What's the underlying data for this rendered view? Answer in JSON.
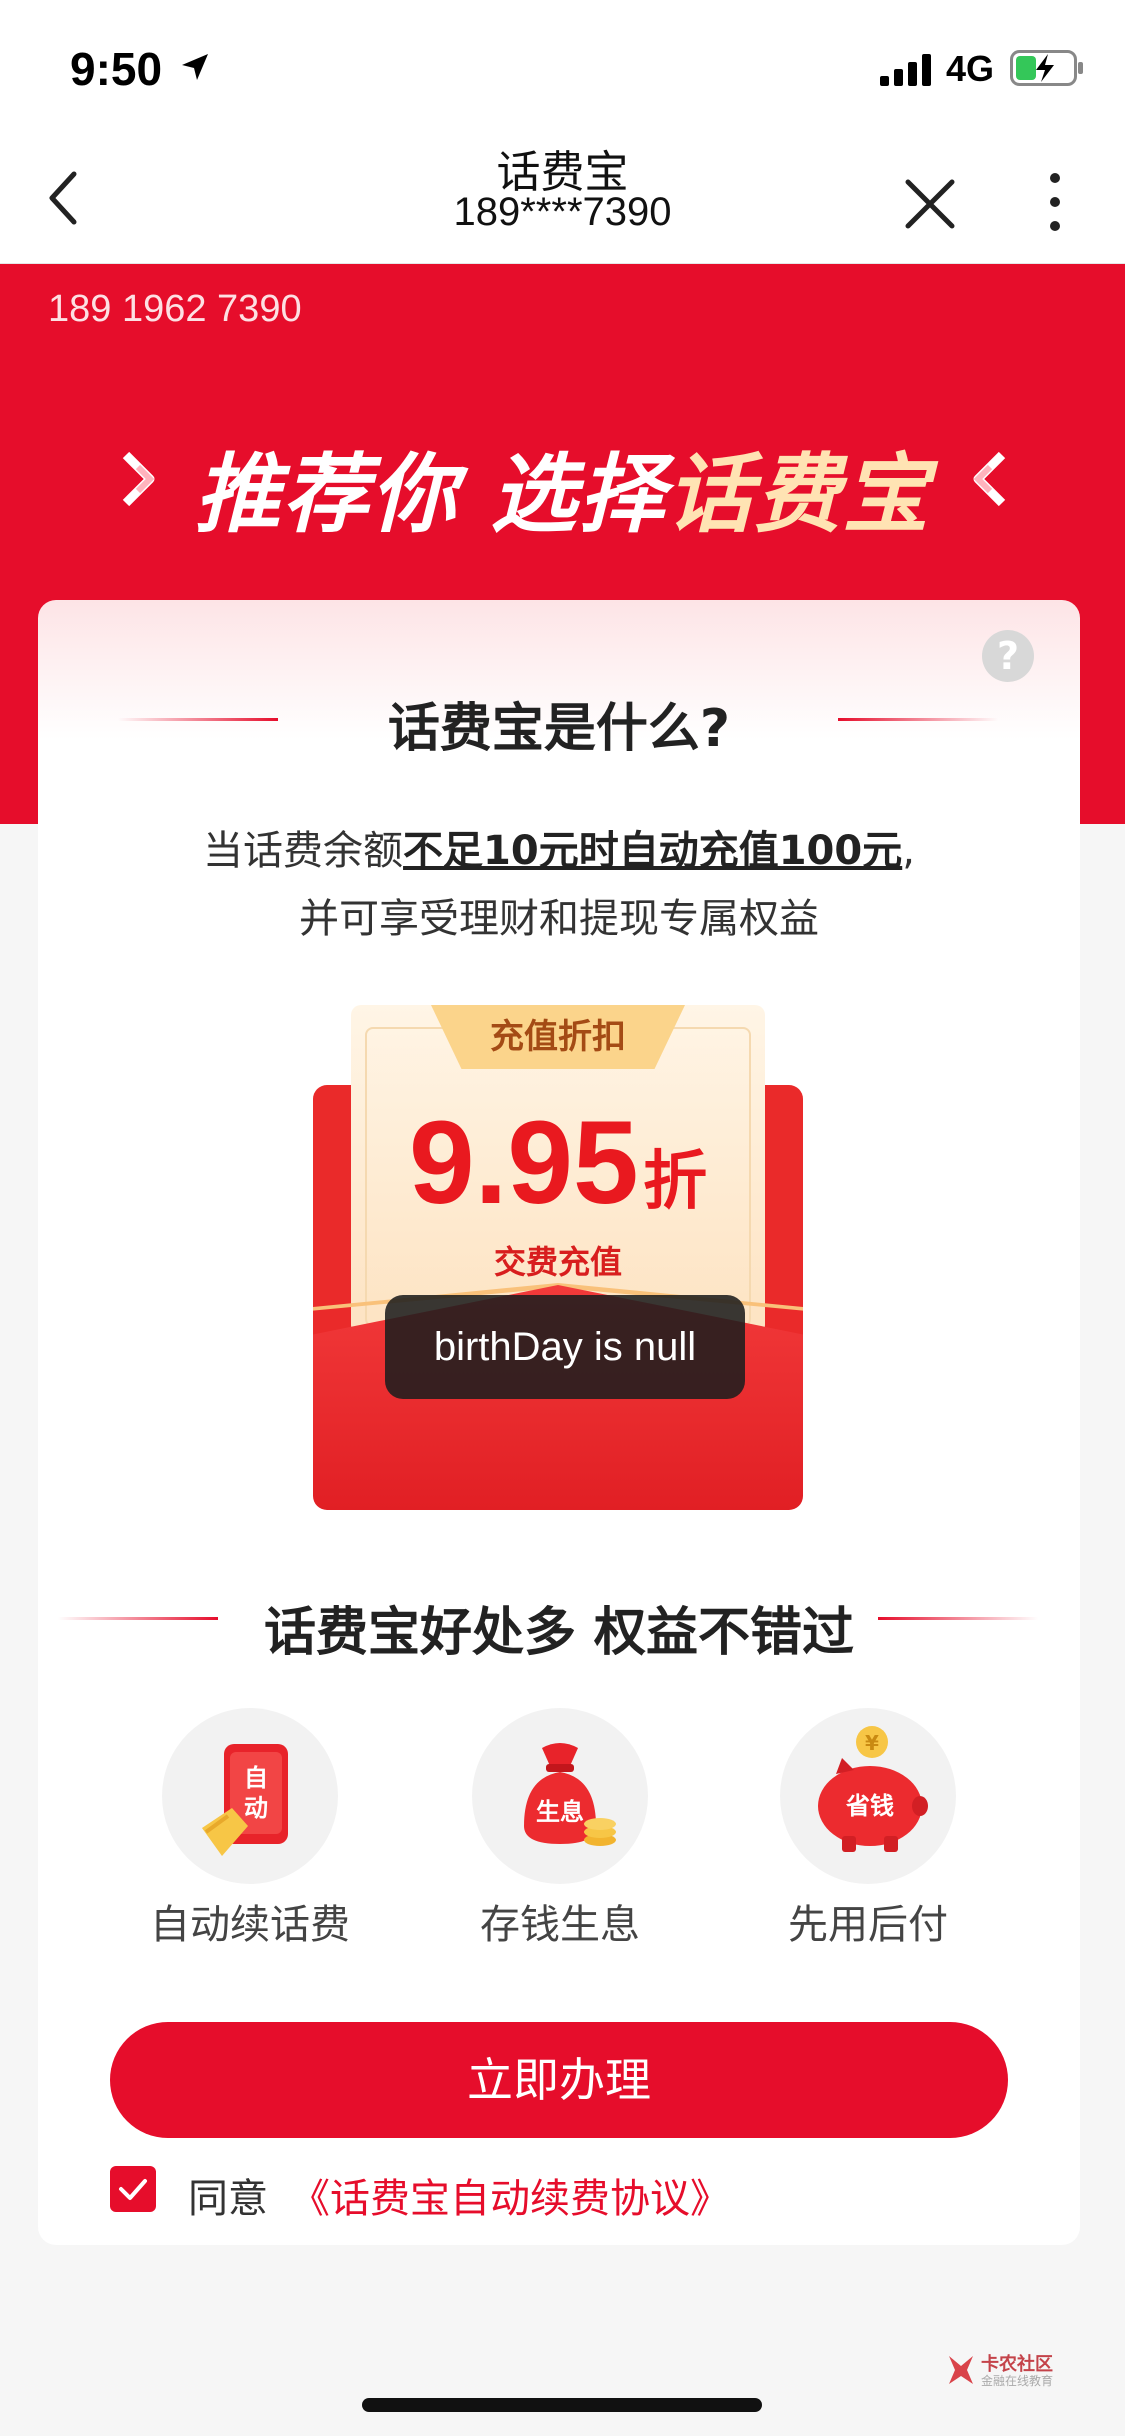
{
  "status_bar": {
    "time": "9:50",
    "network": "4G",
    "icons": [
      "location-arrow-icon",
      "signal-icon",
      "battery-charging-icon"
    ]
  },
  "nav": {
    "title": "话费宝",
    "subtitle": "189****7390",
    "icons": [
      "back-icon",
      "close-icon",
      "more-icon"
    ]
  },
  "hero": {
    "phone": "189 1962 7390",
    "title_part1": "推荐你 选择",
    "title_part2": "话费宝"
  },
  "card": {
    "what_title": "话费宝是什么?",
    "desc_prefix": "当话费余额",
    "desc_highlight": "不足10元时自动充值100元",
    "desc_suffix": ",",
    "desc_line2": "并可享受理财和提现专属权益",
    "envelope": {
      "tag": "充值折扣",
      "discount_value": "9.95",
      "discount_unit": "折",
      "subtitle": "交费充值"
    },
    "toast": "birthDay is null",
    "benefits_title": "话费宝好处多 权益不错过",
    "benefits": [
      {
        "label": "自动续话费",
        "icon": "auto-renew-phone-icon",
        "icon_text": "自动"
      },
      {
        "label": "存钱生息",
        "icon": "money-bag-icon",
        "icon_text": "生息"
      },
      {
        "label": "先用后付",
        "icon": "piggy-bank-icon",
        "icon_text": "省钱"
      }
    ],
    "primary_button": "立即办理",
    "agree_label": "同意",
    "agree_link": "《话费宝自动续费协议》",
    "agree_checked": true
  },
  "watermark": {
    "text": "卡农社区",
    "subtext": "金融在线教育"
  },
  "colors": {
    "brand_red": "#e60d2b",
    "hero_highlight": "#ffe3b3"
  }
}
